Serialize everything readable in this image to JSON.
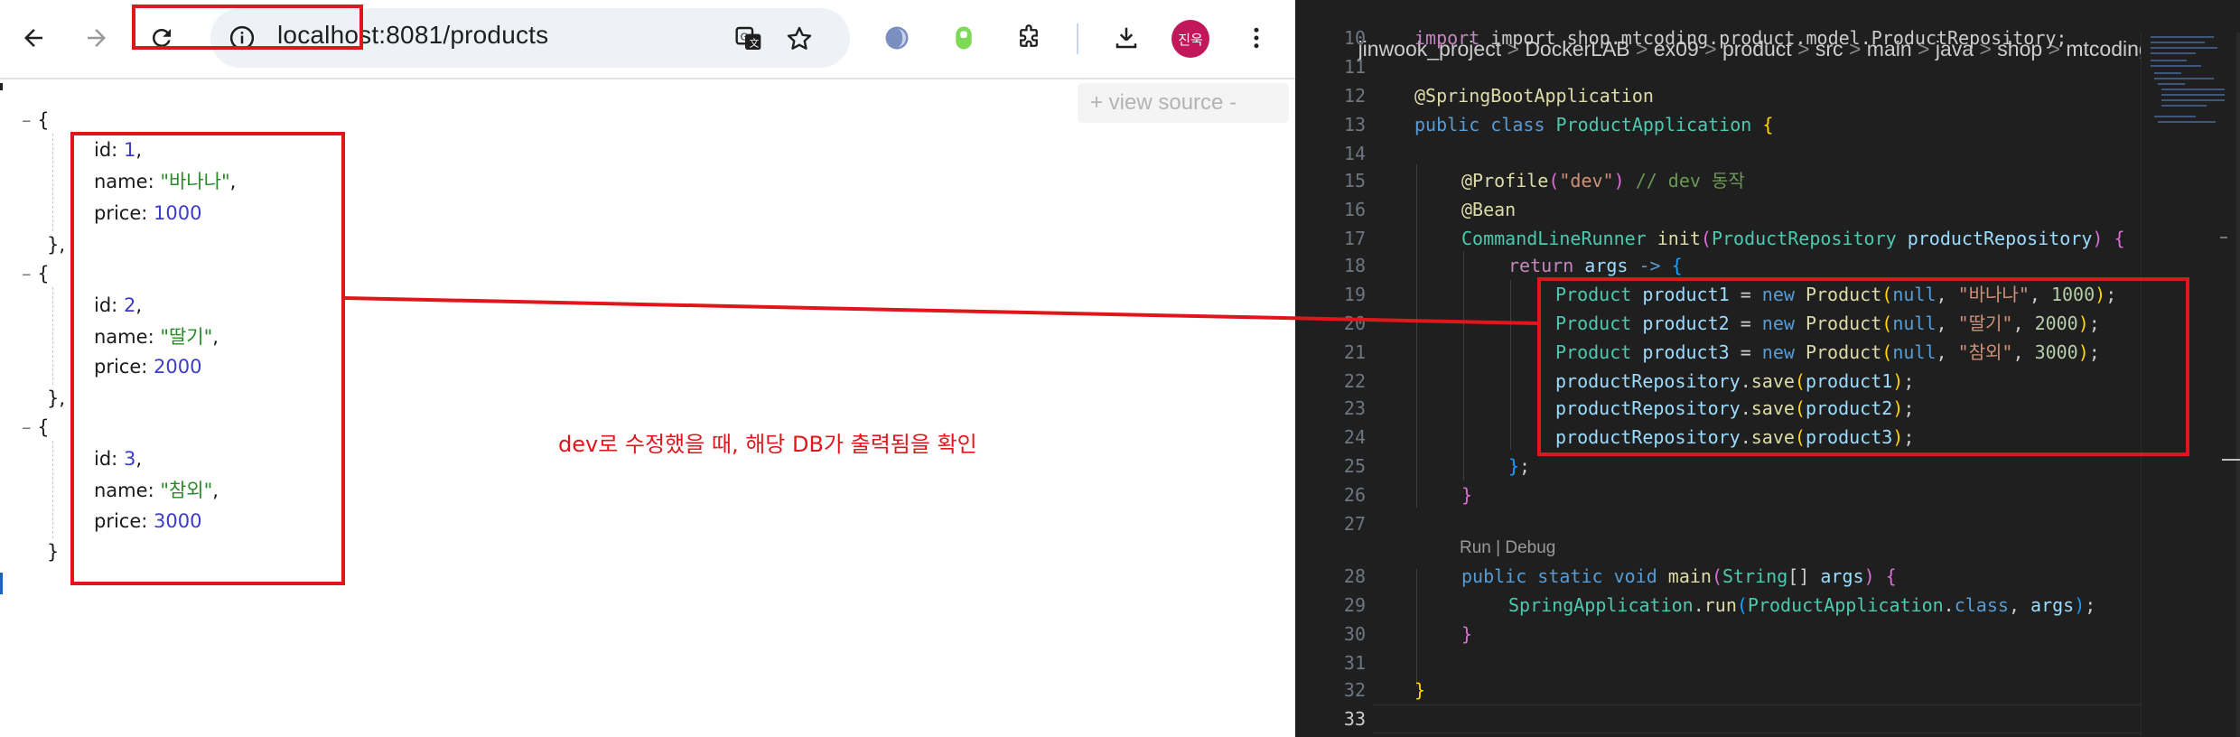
{
  "browser": {
    "url": "localhost:8081/products",
    "avatar_text": "진욱",
    "view_source_label": "+ view source -",
    "json": {
      "items": [
        {
          "id_key": "id",
          "id_val": "1",
          "name_key": "name",
          "name_val": "\"바나나\"",
          "price_key": "price",
          "price_val": "1000"
        },
        {
          "id_key": "id",
          "id_val": "2",
          "name_key": "name",
          "name_val": "\"딸기\"",
          "price_key": "price",
          "price_val": "2000"
        },
        {
          "id_key": "id",
          "id_val": "3",
          "name_key": "name",
          "name_val": "\"참외\"",
          "price_key": "price",
          "price_val": "3000"
        }
      ]
    }
  },
  "annotation": {
    "text": "dev로 수정했을 때, 해당 DB가 출력됨을 확인",
    "color": "#e0161c"
  },
  "editor": {
    "breadcrumb": [
      "jinwook_project",
      "DockerLAB",
      "ex09",
      "product",
      "src",
      "main",
      "java",
      "shop",
      "mtcoding",
      "product"
    ],
    "line_numbers": [
      "10",
      "11",
      "12",
      "13",
      "14",
      "15",
      "16",
      "17",
      "18",
      "19",
      "20",
      "21",
      "22",
      "23",
      "24",
      "25",
      "26",
      "27",
      "28",
      "29",
      "30",
      "31",
      "32",
      "33"
    ],
    "codelens": "Run | Debug",
    "code": {
      "l10": "import shop.mtcoding.product.model.ProductRepository;",
      "l12": "@SpringBootApplication",
      "l13_kw": "public class",
      "l13_cls": "ProductApplication",
      "l15_ann": "@Profile",
      "l15_str": "\"dev\"",
      "l15_cmt": "// dev 동작",
      "l16": "@Bean",
      "l17_cls": "CommandLineRunner",
      "l17_fn": "init",
      "l17_cls2": "ProductRepository",
      "l17_var": "productRepository",
      "l18_kw": "return",
      "l18_var": "args",
      "l19_var": "product1",
      "l19_str": "\"바나나\"",
      "l19_num": "1000",
      "l20_var": "product2",
      "l20_str": "\"딸기\"",
      "l20_num": "2000",
      "l21_var": "product3",
      "l21_str": "\"참외\"",
      "l21_num": "3000",
      "l28_kw": "public static void",
      "l28_fn": "main",
      "l28_cls": "String",
      "l28_var": "args",
      "l29_cls": "SpringApplication",
      "l29_fn": "run",
      "l29_cls2": "ProductApplication",
      "l29_kw": "class"
    }
  }
}
